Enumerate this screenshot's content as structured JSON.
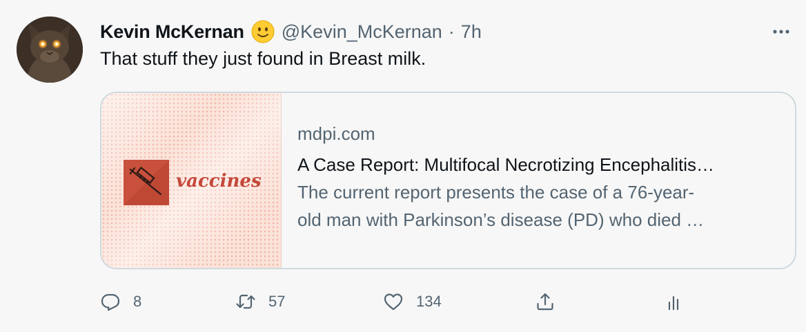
{
  "tweet": {
    "display_name": "Kevin McKernan",
    "name_emoji": "slightly-smiling-face-emoji",
    "handle": "@Kevin_McKernan",
    "separator": "·",
    "time": "7h",
    "text": "That stuff they just found in Breast milk."
  },
  "card": {
    "image_label": "vaccines",
    "domain": "mdpi.com",
    "title": "A Case Report: Multifocal Necrotizing Encephalitis…",
    "description_lines": [
      "The current report presents the case of a 76-year-",
      "old man with Parkinson’s disease (PD) who died …"
    ]
  },
  "actions": {
    "reply": {
      "icon": "reply-icon",
      "count": "8"
    },
    "retweet": {
      "icon": "retweet-icon",
      "count": "57"
    },
    "like": {
      "icon": "heart-icon",
      "count": "134"
    },
    "share": {
      "icon": "share-icon"
    },
    "analytics": {
      "icon": "analytics-icon"
    }
  },
  "colors": {
    "background": "#f7f7f7",
    "text_primary": "#0f1419",
    "text_secondary": "#536471",
    "card_border": "#cfd9de",
    "journal_red": "#c4493a"
  }
}
